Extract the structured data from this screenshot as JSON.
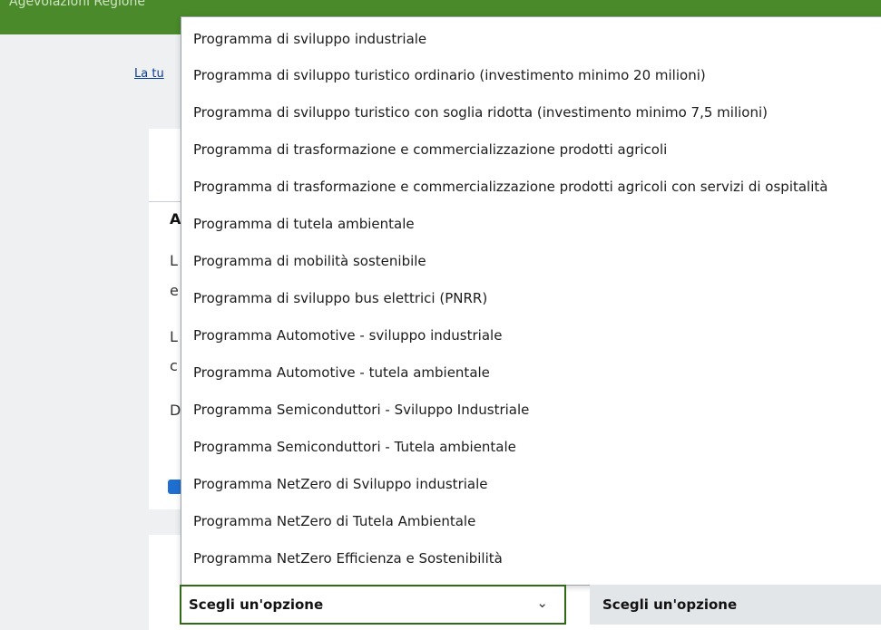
{
  "header": {
    "faint_text": "Agevolazioni Regione"
  },
  "background": {
    "link_fragment": "La tu",
    "peek_lines": [
      {
        "text": "A",
        "bold": true
      },
      {
        "text": "L",
        "bold": false
      },
      {
        "text": "e",
        "bold": false
      },
      {
        "text": "L",
        "bold": false
      },
      {
        "text": "c",
        "bold": false
      },
      {
        "text": "D",
        "bold": false
      }
    ]
  },
  "dropdown": {
    "options": [
      "Programma di sviluppo industriale",
      "Programma di sviluppo turistico ordinario (investimento minimo 20 milioni)",
      "Programma di sviluppo turistico con soglia ridotta (investimento minimo 7,5 milioni)",
      "Programma di trasformazione e commercializzazione prodotti agricoli",
      "Programma di trasformazione e commercializzazione prodotti agricoli con servizi di ospitalità",
      "Programma di tutela ambientale",
      "Programma di mobilità sostenibile",
      "Programma di sviluppo bus elettrici (PNRR)",
      "Programma Automotive - sviluppo industriale",
      "Programma Automotive - tutela ambientale",
      "Programma Semiconduttori - Sviluppo Industriale",
      "Programma Semiconduttori - Tutela ambientale",
      "Programma NetZero di Sviluppo industriale",
      "Programma NetZero di Tutela Ambientale",
      "Programma NetZero Efficienza e Sostenibilità"
    ]
  },
  "select_primary": {
    "value": "Scegli un'opzione",
    "icon": "chevron-down-icon"
  },
  "select_secondary": {
    "value": "Scegli un'opzione"
  },
  "colors": {
    "header_green": "#4a8a2a",
    "select_border": "#2e6b14",
    "checkbox_blue": "#1f6fd1"
  }
}
